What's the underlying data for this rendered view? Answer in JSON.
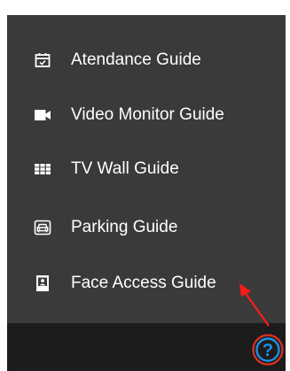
{
  "menu": {
    "items": [
      {
        "label": "Atendance Guide",
        "icon": "calendar-check-icon"
      },
      {
        "label": "Video Monitor Guide",
        "icon": "video-camera-icon"
      },
      {
        "label": "TV Wall Guide",
        "icon": "tv-wall-grid-icon"
      },
      {
        "label": "Parking Guide",
        "icon": "car-icon"
      },
      {
        "label": "Face Access Guide",
        "icon": "face-access-icon"
      }
    ]
  },
  "help": {
    "glyph": "?",
    "icon": "help-icon"
  },
  "colors": {
    "menu_bg": "#3a3a3a",
    "bottom_bar_bg": "#1c1c1c",
    "text": "#ffffff",
    "help_blue": "#1e8fe6",
    "annotation_red": "#ff1a1a",
    "help_ring_red": "#e03020"
  }
}
